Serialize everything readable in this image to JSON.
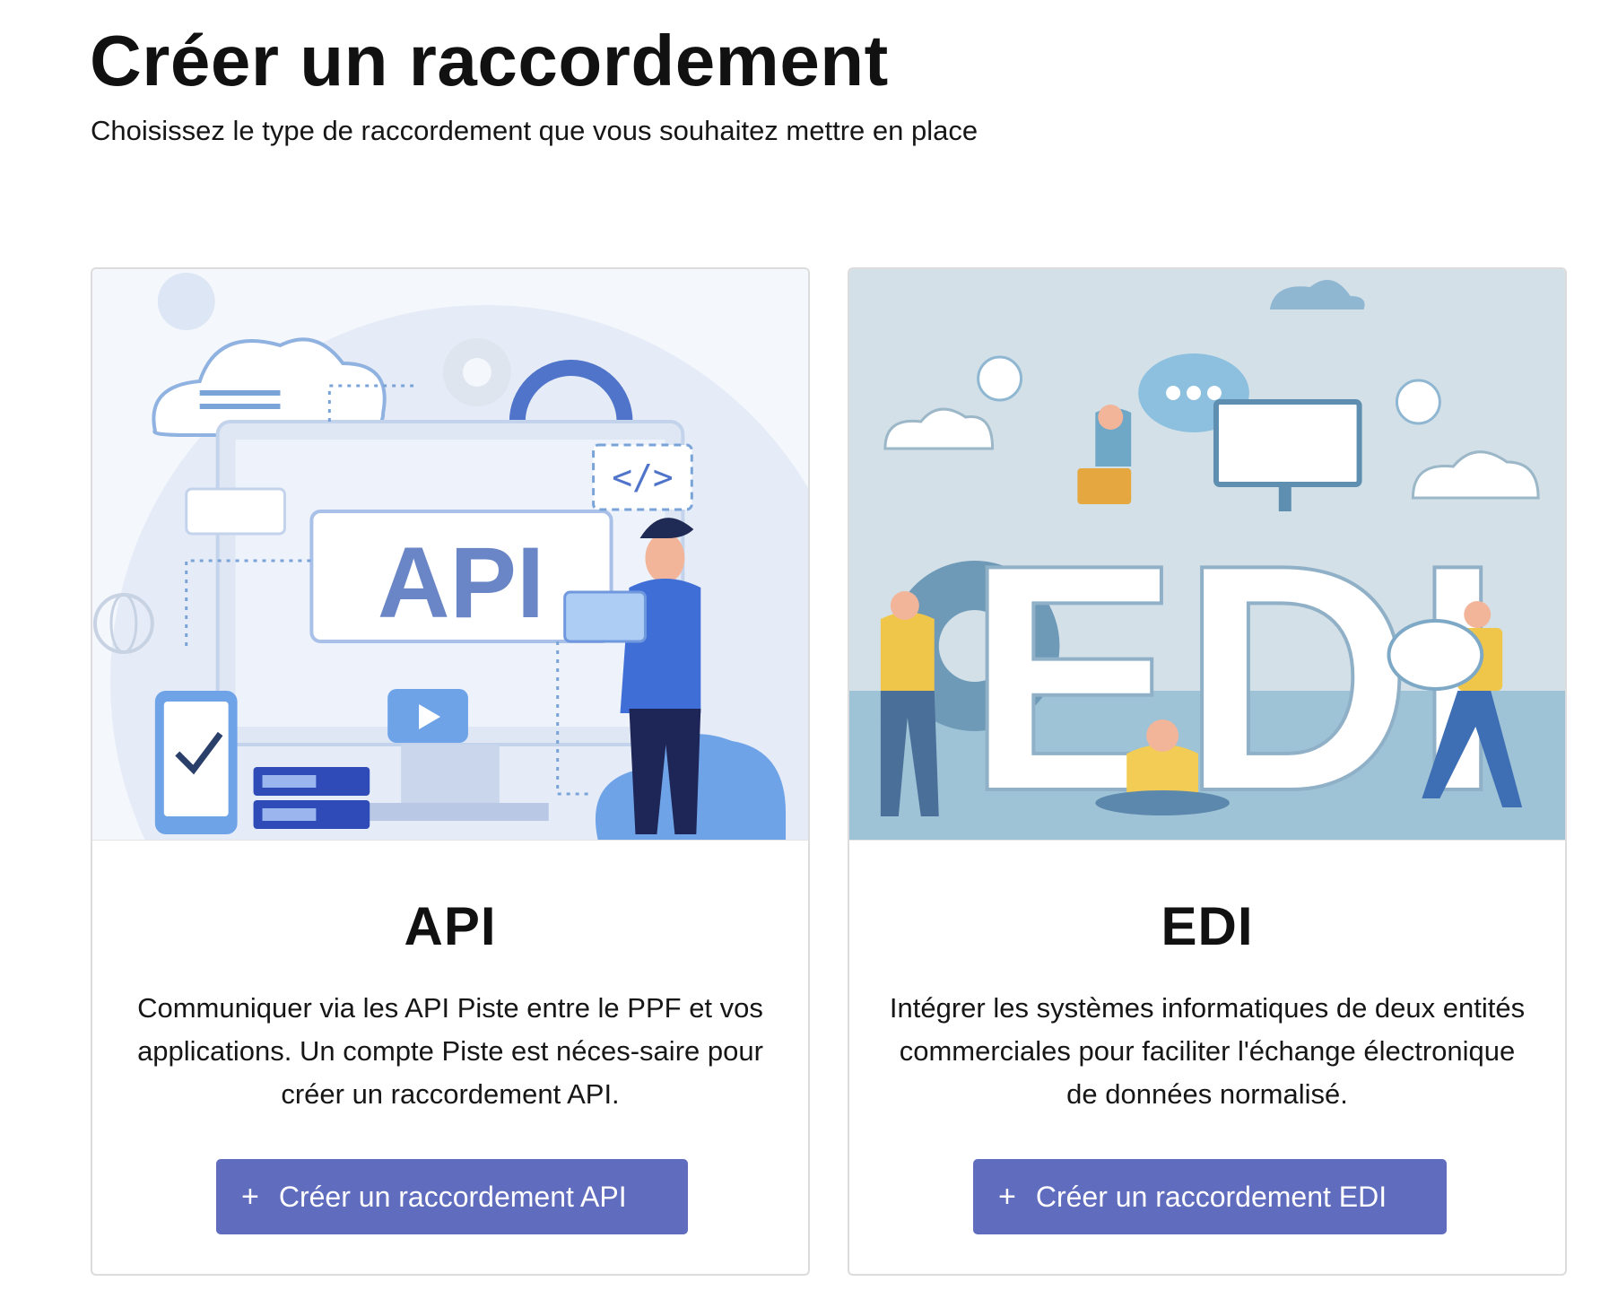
{
  "page": {
    "title": "Créer un raccordement",
    "subtitle": "Choisissez le type de raccordement que vous souhaitez mettre en place"
  },
  "cards": [
    {
      "illustration_text": "API",
      "title": "API",
      "description": "Communiquer via les API Piste entre le PPF et vos applications. Un compte Piste est néces-saire pour créer un raccordement API.",
      "button": {
        "icon": "plus-icon",
        "icon_glyph": "+",
        "label": "Créer un raccordement API"
      }
    },
    {
      "illustration_text": "EDI",
      "title": "EDI",
      "description": "Intégrer les systèmes informatiques de deux entités commerciales pour faciliter l'échange électronique de données normalisé.",
      "button": {
        "icon": "plus-icon",
        "icon_glyph": "+",
        "label": "Créer un raccordement EDI"
      }
    }
  ],
  "colors": {
    "button_bg": "#606cbe",
    "api_illustration_bg": "#e8eef8",
    "edi_illustration_bg": "#cfdde6"
  }
}
